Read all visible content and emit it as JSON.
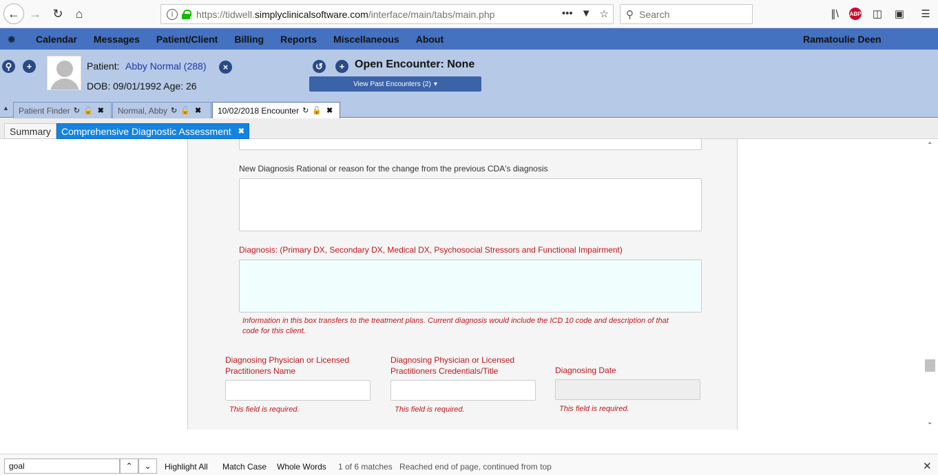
{
  "browser": {
    "url_prefix": "https://tidwell.",
    "url_host": "simplyclinicalsoftware.com",
    "url_path": "/interface/main/tabs/main.php",
    "search_placeholder": "Search",
    "addon_badge": "ABP"
  },
  "app_nav": {
    "menu": [
      "Calendar",
      "Messages",
      "Patient/Client",
      "Billing",
      "Reports",
      "Miscellaneous",
      "About"
    ],
    "user": "Ramatoulie Deen"
  },
  "patient": {
    "label": "Patient:",
    "name": "Abby Normal (288)",
    "dob_line": "DOB: 09/01/1992 Age: 26",
    "encounter": "Open Encounter: None",
    "past_encounters_btn": "View Past Encounters  (2)"
  },
  "tabs": [
    {
      "label": "Patient Finder"
    },
    {
      "label": "Normal, Abby"
    },
    {
      "label": "10/02/2018 Encounter"
    }
  ],
  "subtabs": {
    "summary": "Summary",
    "cda": "Comprehensive Diagnostic Assessment"
  },
  "form": {
    "rational_label": "New Diagnosis Rational or reason for the change from the previous CDA's diagnosis",
    "diagnosis_label": "Diagnosis: (Primary DX, Secondary DX, Medical DX, Psychosocial Stressors and Functional Impairment)",
    "diagnosis_note": "Information in this box transfers to the treatment plans. Current diagnosis would include the ICD 10 code and description of that code for this client.",
    "physician_name_label": "Diagnosing Physician or Licensed Practitioners Name",
    "physician_cred_label": "Diagnosing Physician or Licensed Practitioners Credentials/Title",
    "diag_date_label": "Diagnosing Date",
    "required_msg": "This field is required."
  },
  "find_bar": {
    "query": "goal",
    "highlight_all": "Highlight All",
    "match_case": "Match Case",
    "whole_words": "Whole Words",
    "count": "1 of 6 matches",
    "status": "Reached end of page, continued from top"
  },
  "colors": {
    "nav_bg": "#4471c0",
    "header_bg": "#b6c9e6",
    "active_tab": "#1483e0",
    "error_red": "#c0151d"
  }
}
